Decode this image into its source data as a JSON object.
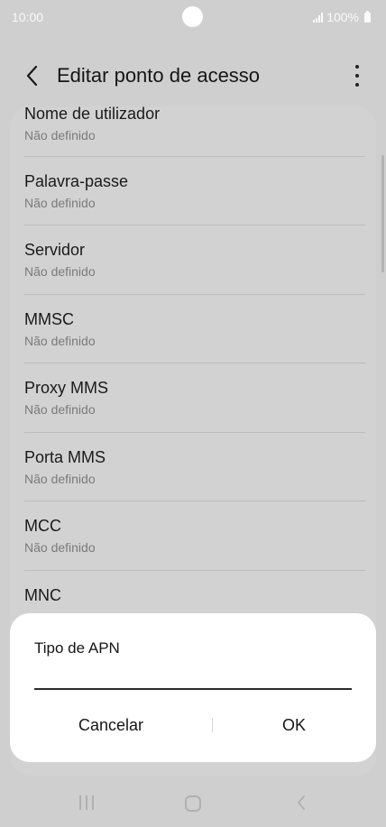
{
  "status_bar": {
    "time": "10:00",
    "battery": "100%",
    "icons": [
      "signal-icon",
      "battery-icon"
    ]
  },
  "header": {
    "title": "Editar ponto de acesso",
    "back_icon": "back-arrow-icon",
    "more_icon": "more-options-icon"
  },
  "settings": [
    {
      "label": "Nome de utilizador",
      "value": "Não definido"
    },
    {
      "label": "Palavra-passe",
      "value": "Não definido"
    },
    {
      "label": "Servidor",
      "value": "Não definido"
    },
    {
      "label": "MMSC",
      "value": "Não definido"
    },
    {
      "label": "Proxy MMS",
      "value": "Não definido"
    },
    {
      "label": "Porta MMS",
      "value": "Não definido"
    },
    {
      "label": "MCC",
      "value": "Não definido"
    },
    {
      "label": "MNC",
      "value": ""
    }
  ],
  "dialog": {
    "title": "Tipo de APN",
    "input_value": "",
    "cancel_label": "Cancelar",
    "ok_label": "OK"
  },
  "nav_bar": {
    "icons": [
      "recents-icon",
      "home-icon",
      "back-icon"
    ]
  },
  "colors": {
    "dim_background": "#cfcfcf",
    "dialog_background": "#ffffff",
    "secondary_text": "#7a7a7a"
  }
}
